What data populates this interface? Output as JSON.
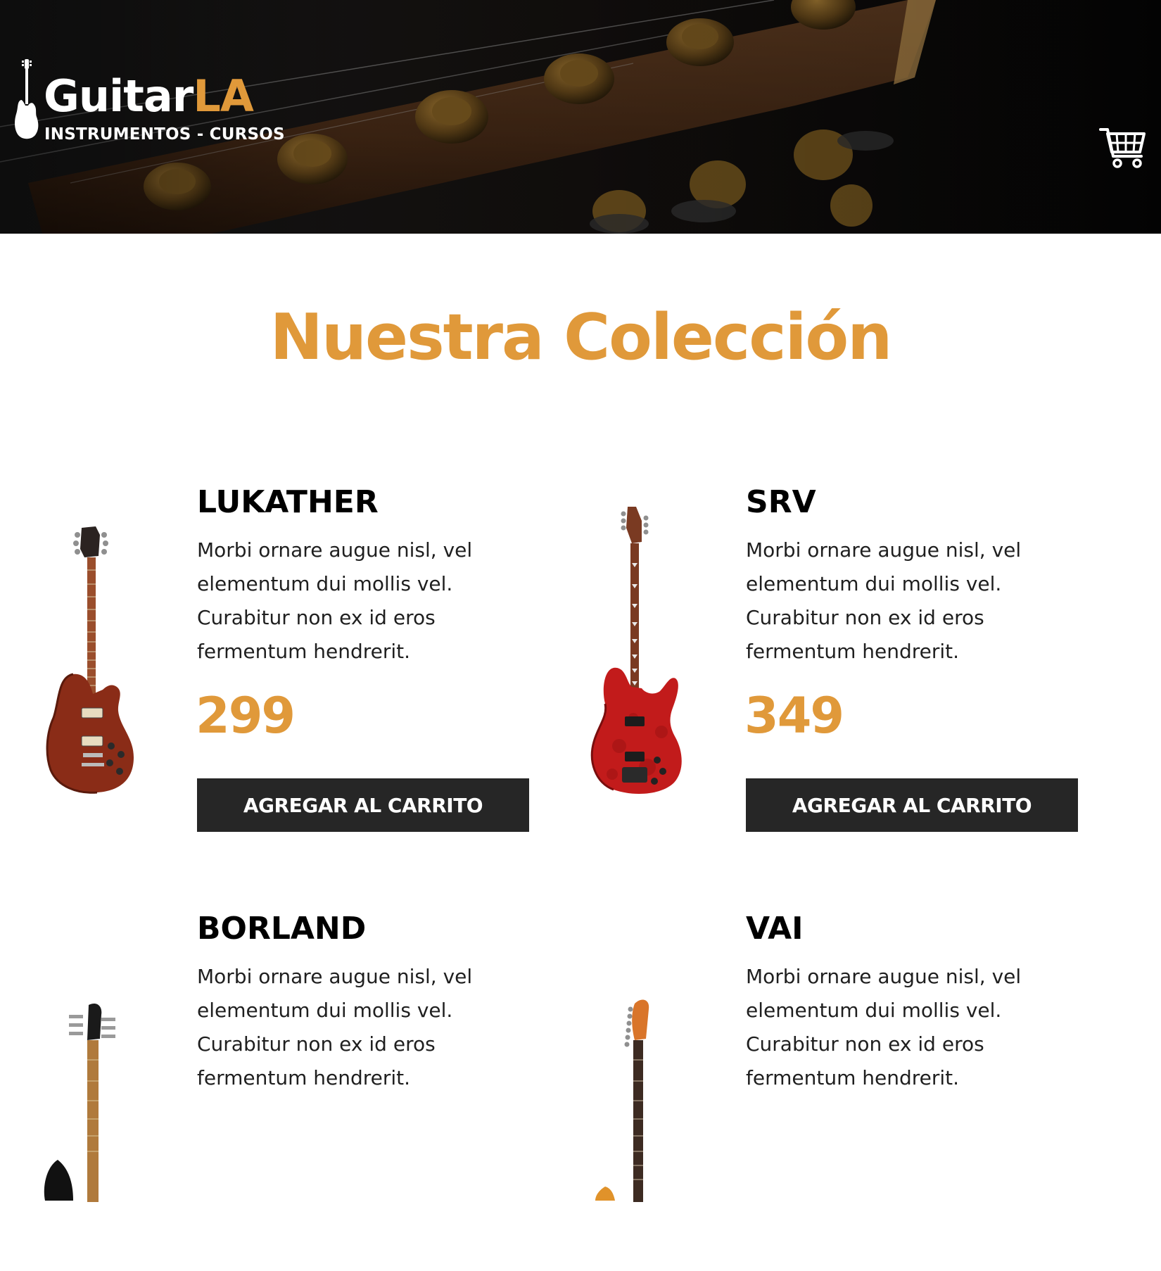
{
  "header": {
    "brand_name_primary": "Guitar",
    "brand_name_accent": "LA",
    "brand_tagline": "INSTRUMENTOS - CURSOS",
    "cart_icon": "shopping-cart-icon"
  },
  "main": {
    "section_title": "Nuestra Colección",
    "products": [
      {
        "name": "LUKATHER",
        "description": "Morbi ornare augue nisl, vel elementum dui mollis vel. Curabitur non ex id eros fermentum hendrerit.",
        "price": "299",
        "button_label": "AGREGAR AL CARRITO",
        "image_icon": "les-paul-guitar-image"
      },
      {
        "name": "SRV",
        "description": "Morbi ornare augue nisl, vel elementum dui mollis vel. Curabitur non ex id eros fermentum hendrerit.",
        "price": "349",
        "button_label": "AGREGAR AL CARRITO",
        "image_icon": "red-superstrat-guitar-image"
      },
      {
        "name": "BORLAND",
        "description": "Morbi ornare augue nisl, vel elementum dui mollis vel. Curabitur non ex id eros fermentum hendrerit.",
        "image_icon": "black-guitar-image"
      },
      {
        "name": "VAI",
        "description": "Morbi ornare augue nisl, vel elementum dui mollis vel. Curabitur non ex id eros fermentum hendrerit.",
        "image_icon": "orange-guitar-image"
      }
    ]
  },
  "colors": {
    "accent": "#e0993a",
    "button_bg": "#262626",
    "header_bg": "#111111"
  }
}
